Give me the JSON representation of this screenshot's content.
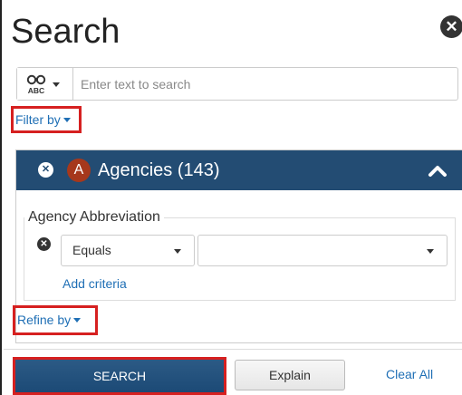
{
  "panel": {
    "title": "Search",
    "close_icon": "close-circle-icon"
  },
  "search": {
    "mode_icon": "binoculars-abc-icon",
    "placeholder": "Enter text to search",
    "value": ""
  },
  "filter": {
    "label": "Filter by"
  },
  "facet": {
    "remove_icon": "remove-circle-icon",
    "avatar_letter": "A",
    "title": "Agencies (143)",
    "collapse_icon": "chevron-up-icon",
    "header_color": "#234c73",
    "avatar_color": "#a6381c"
  },
  "criteria": {
    "legend": "Agency Abbreviation",
    "remove_icon": "remove-circle-icon",
    "operator": "Equals",
    "value": "",
    "add_label": "Add criteria"
  },
  "refine": {
    "label": "Refine by"
  },
  "actions": {
    "search_label": "SEARCH",
    "explain_label": "Explain",
    "clear_label": "Clear All"
  },
  "colors": {
    "highlight": "#d62020",
    "link": "#1f6fb5"
  }
}
